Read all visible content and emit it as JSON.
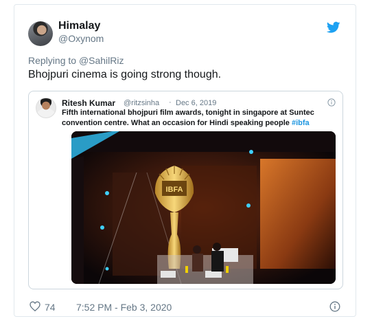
{
  "tweet": {
    "author_name": "Himalay",
    "author_handle": "@Oxynom",
    "replying_prefix": "Replying to",
    "replying_to": "@SahilRiz",
    "text": "Bhojpuri cinema is going strong though.",
    "likes": "74",
    "timestamp": "7:52 PM - Feb 3, 2020"
  },
  "quoted": {
    "author_name": "Ritesh Kumar",
    "author_handle": "@ritzsinha",
    "separator": "·",
    "date": "Dec 6, 2019",
    "text": "Fifth international bhojpuri film awards, tonight in singapore at Suntec convention centre. What an occasion for Hindi speaking people",
    "hashtag": "#ibfa",
    "media_logo": "IBFA"
  },
  "colors": {
    "twitter_blue": "#1da1f2",
    "link_blue": "#1b95e0",
    "muted": "#657786"
  },
  "icons": [
    "twitter-bird-icon",
    "info-icon",
    "heart-icon"
  ]
}
